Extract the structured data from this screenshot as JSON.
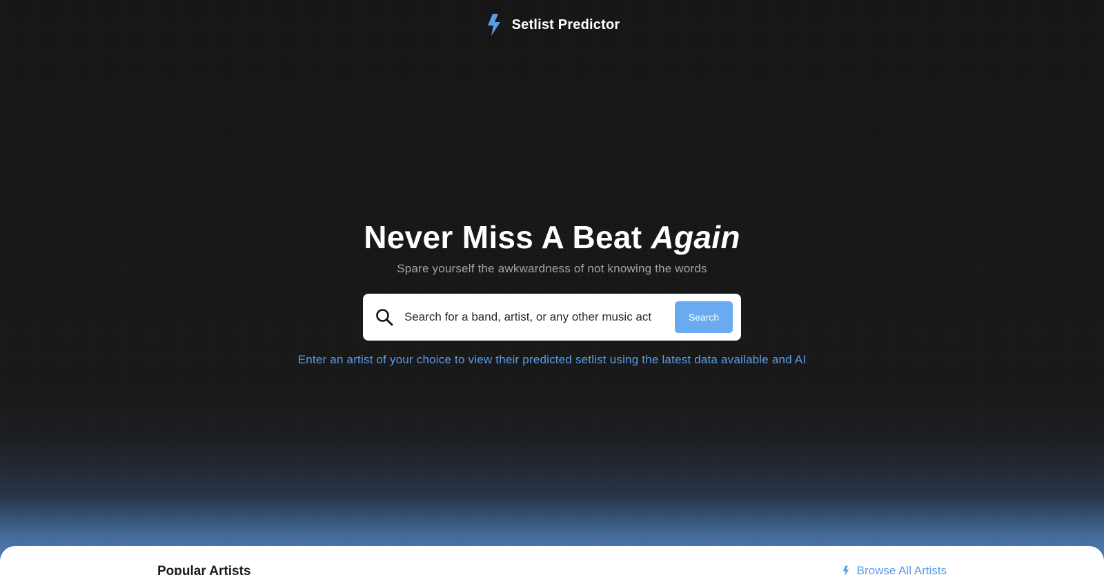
{
  "header": {
    "brand": "Setlist Predictor",
    "logo_icon": "lightning-bolt-icon"
  },
  "hero": {
    "headline_main": "Never Miss A Beat ",
    "headline_emphasis": "Again",
    "subheadline": "Spare yourself the awkwardness of not knowing the words"
  },
  "search": {
    "icon": "search-icon",
    "placeholder": "Search for a band, artist, or any other music act",
    "value": "",
    "button_label": "Search",
    "helper_text": "Enter an artist of your choice to view their predicted setlist using the latest data available and AI"
  },
  "popular": {
    "title": "Popular Artists",
    "browse_label": "Browse All Artists",
    "browse_icon": "lightning-bolt-icon"
  },
  "colors": {
    "accent": "#5b9ce6",
    "button": "#6aaaf0",
    "background": "#151515",
    "panel": "#ffffff"
  }
}
